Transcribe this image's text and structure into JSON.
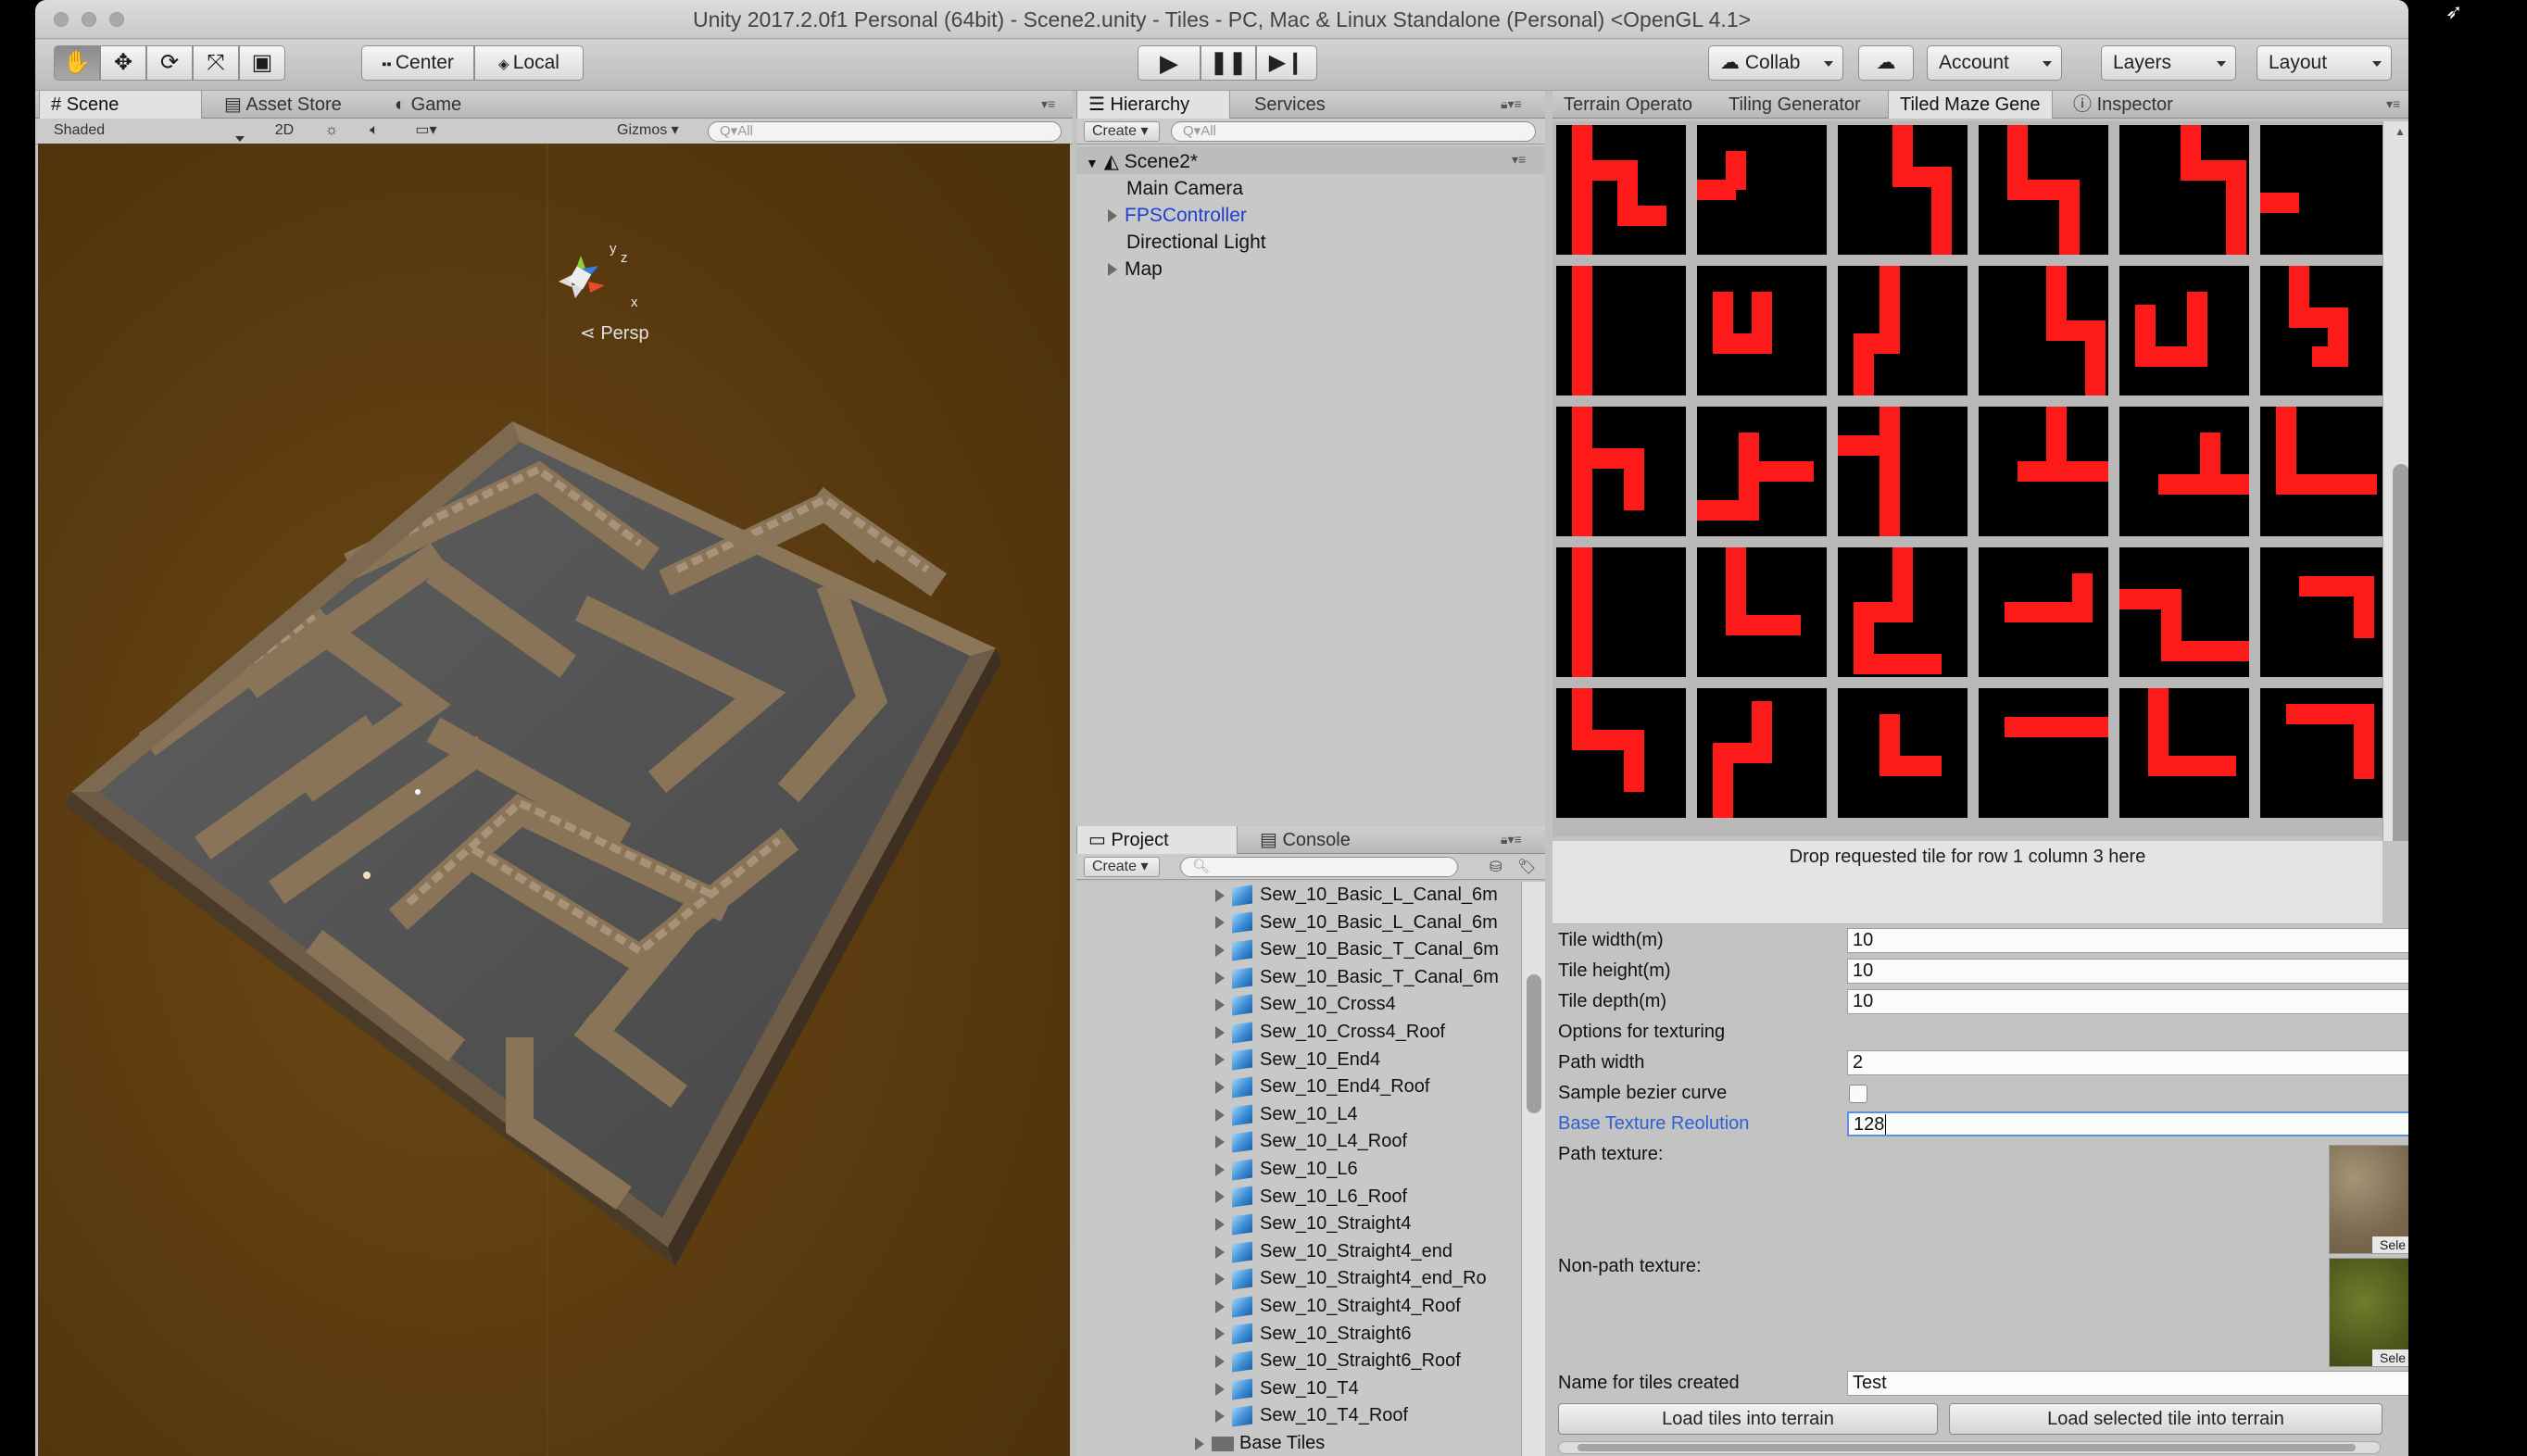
{
  "window": {
    "title": "Unity 2017.2.0f1 Personal (64bit) - Scene2.unity - Tiles - PC, Mac & Linux Standalone (Personal) <OpenGL 4.1>"
  },
  "toolbar": {
    "tools": [
      "hand-tool",
      "move-tool",
      "rotate-tool",
      "scale-tool",
      "rect-tool"
    ],
    "center_label": "Center",
    "local_label": "Local",
    "collab_label": "Collab",
    "account_label": "Account",
    "layers_label": "Layers",
    "layout_label": "Layout"
  },
  "scene_panel": {
    "tabs": [
      "Scene",
      "Asset Store",
      "Game"
    ],
    "shading": "Shaded",
    "mode_2d": "2D",
    "gizmos": "Gizmos",
    "search_placeholder": "Q▾All",
    "persp_label": "Persp",
    "gizmo_axes": {
      "x": "x",
      "y": "y",
      "z": "z"
    }
  },
  "hierarchy": {
    "tabs": [
      "Hierarchy",
      "Services"
    ],
    "create_label": "Create",
    "search_placeholder": "Q▾All",
    "scene_name": "Scene2*",
    "items": [
      {
        "label": "Main Camera",
        "arrow": false,
        "prefab": false
      },
      {
        "label": "FPSController",
        "arrow": true,
        "prefab": true
      },
      {
        "label": "Directional Light",
        "arrow": false,
        "prefab": false
      },
      {
        "label": "Map",
        "arrow": true,
        "prefab": false
      }
    ]
  },
  "project": {
    "tabs": [
      "Project",
      "Console"
    ],
    "create_label": "Create",
    "items": [
      "Sew_10_Basic_L_Canal_6m",
      "Sew_10_Basic_L_Canal_6m",
      "Sew_10_Basic_T_Canal_6m",
      "Sew_10_Basic_T_Canal_6m",
      "Sew_10_Cross4",
      "Sew_10_Cross4_Roof",
      "Sew_10_End4",
      "Sew_10_End4_Roof",
      "Sew_10_L4",
      "Sew_10_L4_Roof",
      "Sew_10_L6",
      "Sew_10_L6_Roof",
      "Sew_10_Straight4",
      "Sew_10_Straight4_end",
      "Sew_10_Straight4_end_Ro",
      "Sew_10_Straight4_Roof",
      "Sew_10_Straight6",
      "Sew_10_Straight6_Roof",
      "Sew_10_T4",
      "Sew_10_T4_Roof"
    ],
    "folder_label": "Base Tiles"
  },
  "right_panel": {
    "tabs": [
      "Terrain Operato",
      "Tiling Generator",
      "Tiled Maze Gene",
      "Inspector"
    ],
    "drop_message": "Drop requested tile for row 1 column 3 here",
    "fields": {
      "tile_width_label": "Tile width(m)",
      "tile_width_value": "10",
      "tile_height_label": "Tile height(m)",
      "tile_height_value": "10",
      "tile_depth_label": "Tile depth(m)",
      "tile_depth_value": "10",
      "options_label": "Options for texturing",
      "path_width_label": "Path width",
      "path_width_value": "2",
      "bezier_label": "Sample bezier curve",
      "base_res_label": "Base Texture Reolution",
      "base_res_value": "128",
      "path_texture_label": "Path texture:",
      "nonpath_texture_label": "Non-path texture:",
      "select_label": "Sele",
      "name_label": "Name for tiles created",
      "name_value": "Test"
    },
    "load_tiles_label": "Load tiles into terrain",
    "load_selected_label": "Load selected tile into terrain"
  },
  "colors": {
    "maze_path": "#ff1a1a",
    "maze_bg": "#000000",
    "scene_bg": "#5b3a10",
    "selection_blue": "#2a62d4"
  }
}
